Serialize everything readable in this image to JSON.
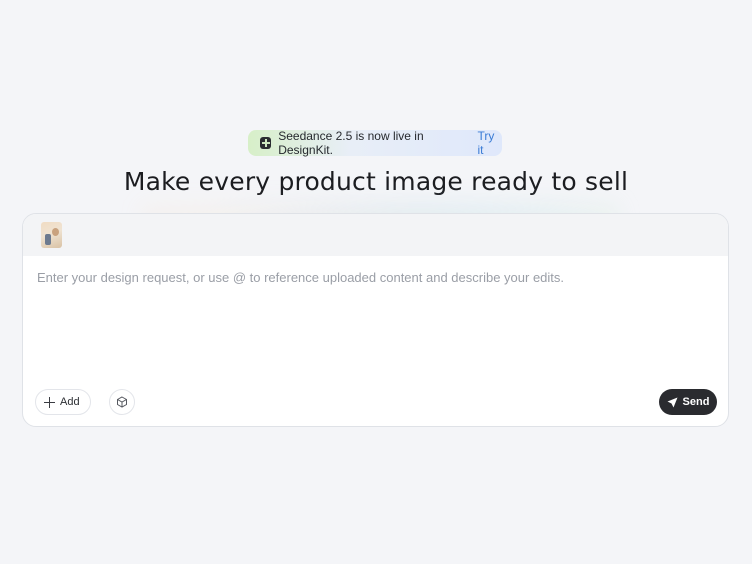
{
  "announcement": {
    "text": "Seedance 2.5 is now live in DesignKit.",
    "link": "Try it",
    "icon": "designkit-logo-icon"
  },
  "headline": "Make every product image ready to sell",
  "prompt": {
    "placeholder": "Enter your design request, or use @ to reference uploaded content and describe your edits.",
    "value": "",
    "attachments": [
      {
        "type": "image-thumbnail"
      }
    ]
  },
  "toolbar": {
    "add_label": "Add",
    "add_icon": "plus-icon",
    "cube_icon": "cube-icon",
    "send_label": "Send",
    "send_icon": "paper-plane-icon"
  },
  "colors": {
    "background": "#f4f5f8",
    "send_button": "#2a2b2f",
    "link": "#3a7bd5"
  }
}
